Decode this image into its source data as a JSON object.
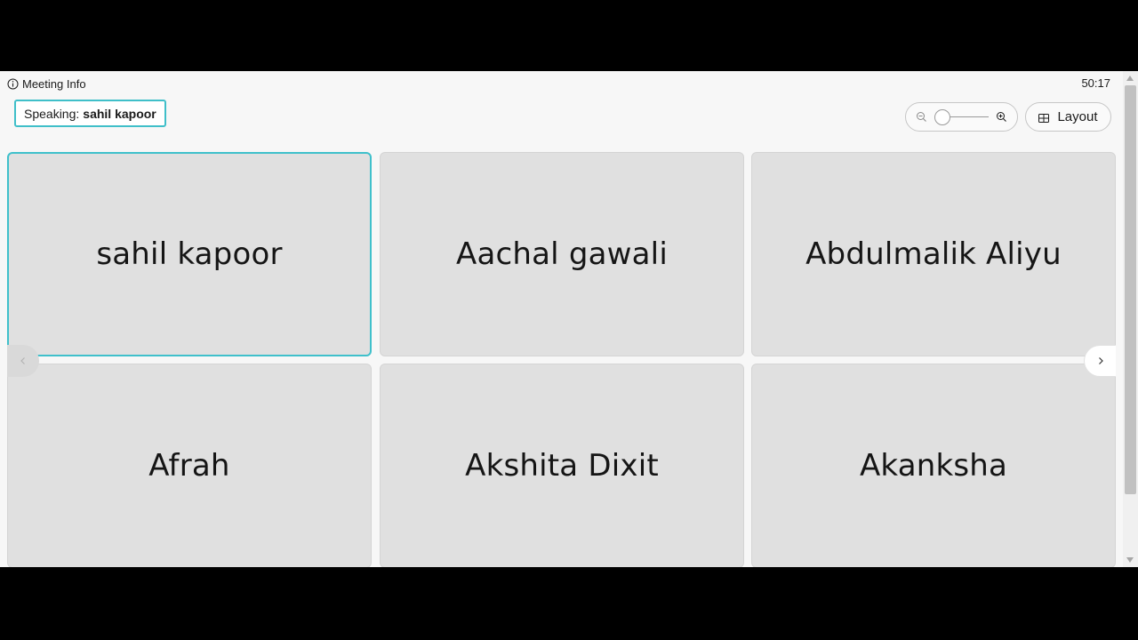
{
  "header": {
    "meeting_info_label": "Meeting Info",
    "timer": "50:17"
  },
  "speaking": {
    "prefix": "Speaking:",
    "name": "sahil kapoor"
  },
  "controls": {
    "layout_label": "Layout",
    "zoom_level": 0.0
  },
  "participants": [
    {
      "name": "sahil kapoor",
      "active": true
    },
    {
      "name": "Aachal gawali",
      "active": false
    },
    {
      "name": "Abdulmalik Aliyu",
      "active": false
    },
    {
      "name": "Afrah",
      "active": false
    },
    {
      "name": "Akshita Dixit",
      "active": false
    },
    {
      "name": "Akanksha",
      "active": false
    }
  ],
  "icons": {
    "meeting_info": "info-icon",
    "zoom_out": "zoom-out-icon",
    "zoom_in": "zoom-in-icon",
    "layout": "grid-icon",
    "prev_page": "chevron-left-icon",
    "next_page": "chevron-right-icon"
  },
  "colors": {
    "active_speaker": "#3fc0cb",
    "tile_background": "#e0e0e0",
    "app_background": "#f7f7f7"
  }
}
